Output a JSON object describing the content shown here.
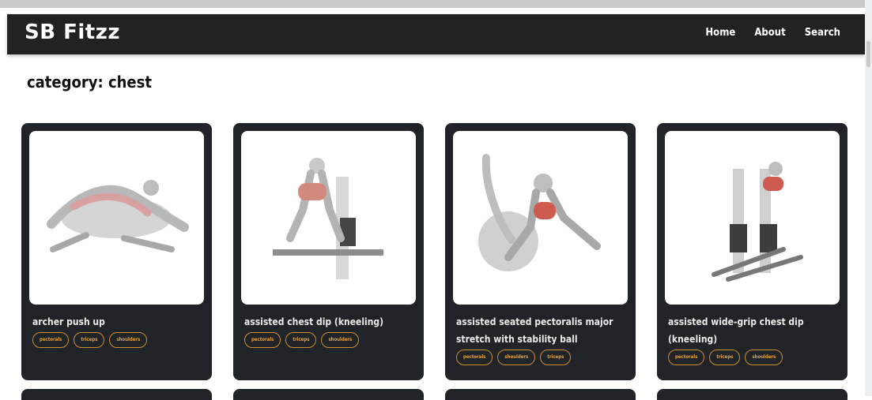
{
  "brand": "SB Fitzz",
  "nav": [
    "Home",
    "About",
    "Search"
  ],
  "heading": {
    "label": "category:",
    "value": "chest"
  },
  "cards": [
    {
      "title": "archer push up",
      "tags": [
        "pectorals",
        "triceps",
        "shoulders"
      ]
    },
    {
      "title": "assisted chest dip (kneeling)",
      "tags": [
        "pectorals",
        "triceps",
        "shoulders"
      ]
    },
    {
      "title": "assisted seated pectoralis major stretch with stability ball",
      "tags": [
        "pectorals",
        "shoulders",
        "triceps"
      ]
    },
    {
      "title": "assisted wide-grip chest dip (kneeling)",
      "tags": [
        "pectorals",
        "triceps",
        "shoulders"
      ]
    }
  ]
}
